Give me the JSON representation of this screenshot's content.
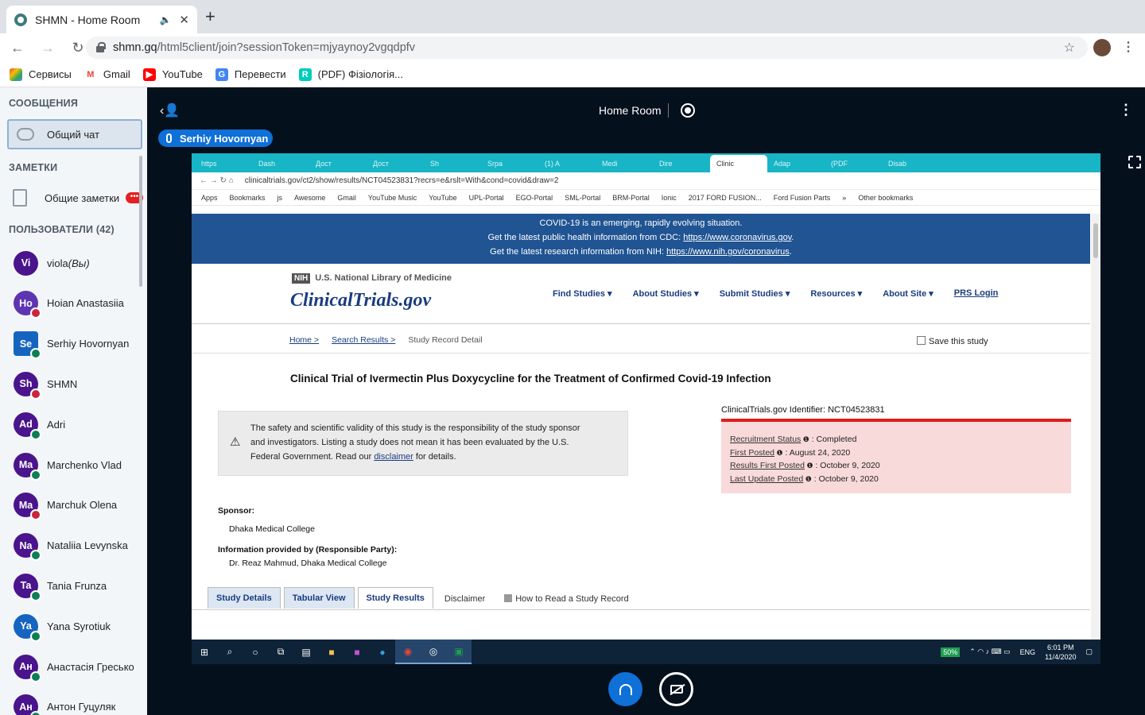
{
  "browser": {
    "tab_title": "SHMN - Home Room",
    "new_tab": "+",
    "url_host": "shmn.gq",
    "url_path": "/html5client/join?sessionToken=mjyaynoy2vgqdpfv",
    "bookmarks": [
      "Сервисы",
      "Gmail",
      "YouTube",
      "Перевести",
      "(PDF) Фізіологія..."
    ]
  },
  "sidebar": {
    "messages_header": "СООБЩЕНИЯ",
    "public_chat": "Общий чат",
    "notes_header": "ЗАМЕТКИ",
    "shared_notes": "Общие заметки",
    "notes_badge": "•••",
    "users_header": "ПОЛЬЗОВАТЕЛИ (42)",
    "users": [
      {
        "initials": "Vi",
        "name": "viola",
        "suffix": " (Вы)",
        "color": "#4a148c",
        "status": "none"
      },
      {
        "initials": "Ho",
        "name": "Hoian Anastasiia",
        "suffix": "",
        "color": "#5e35b1",
        "status": "mic"
      },
      {
        "initials": "Se",
        "name": "Serhiy Hovornyan",
        "suffix": "",
        "color": "#1565c0",
        "status": "hp"
      },
      {
        "initials": "Sh",
        "name": "SHMN",
        "suffix": "",
        "color": "#4a148c",
        "status": "mic"
      },
      {
        "initials": "Ad",
        "name": "Adri",
        "suffix": "",
        "color": "#4a148c",
        "status": "hp"
      },
      {
        "initials": "Ma",
        "name": "Marchenko Vlad",
        "suffix": "",
        "color": "#4a148c",
        "status": "hp"
      },
      {
        "initials": "Ma",
        "name": "Marchuk Olena",
        "suffix": "",
        "color": "#4a148c",
        "status": "mic"
      },
      {
        "initials": "Na",
        "name": "Nataliia Levynska",
        "suffix": "",
        "color": "#4a148c",
        "status": "hp"
      },
      {
        "initials": "Ta",
        "name": "Tania Frunza",
        "suffix": "",
        "color": "#4a148c",
        "status": "hp"
      },
      {
        "initials": "Ya",
        "name": "Yana Syrotiuk",
        "suffix": "",
        "color": "#1565c0",
        "status": "hp"
      },
      {
        "initials": "Ан",
        "name": "Анастасія Гресько",
        "suffix": "",
        "color": "#4a148c",
        "status": "hp"
      },
      {
        "initials": "Ан",
        "name": "Антон Гуцуляк",
        "suffix": "",
        "color": "#4a148c",
        "status": "hp"
      }
    ]
  },
  "room": {
    "title": "Home Room",
    "presenter": "Serhiy Hovornyan"
  },
  "shared": {
    "tabs": [
      "https",
      "Dash",
      "Дост",
      "Дост",
      "Sh",
      "Srpa",
      "(1) A",
      "Medi",
      "Dire",
      "Clinic",
      "Adap",
      "(PDF",
      "Disab"
    ],
    "active_tab": 9,
    "url": "clinicaltrials.gov/ct2/show/results/NCT04523831?recrs=e&rslt=With&cond=covid&draw=2",
    "bookmarks": [
      "Apps",
      "Bookmarks",
      "js",
      "Awesome",
      "Gmail",
      "YouTube Music",
      "YouTube",
      "UPL-Portal",
      "EGO-Portal",
      "SML-Portal",
      "BRM-Portal",
      "Ionic",
      "2017 FORD FUSION...",
      "Ford Fusion Parts",
      "»",
      "Other bookmarks"
    ],
    "banner_line1": "COVID-19 is an emerging, rapidly evolving situation.",
    "banner_line2": "Get the latest public health information from CDC: ",
    "banner_link2": "https://www.coronavirus.gov",
    "banner_line3": "Get the latest research information from NIH: ",
    "banner_link3": "https://www.nih.gov/coronavirus",
    "nih_badge": "NIH",
    "nih_label": "U.S. National Library of Medicine",
    "site_logo": "ClinicalTrials.gov",
    "nav": [
      "Find Studies ▾",
      "About Studies ▾",
      "Submit Studies ▾",
      "Resources ▾",
      "About Site ▾",
      "PRS Login"
    ],
    "crumbs": [
      "Home >",
      "Search Results >",
      "Study Record Detail"
    ],
    "save_label": "Save this study",
    "study_title": "Clinical Trial of Ivermectin Plus Doxycycline for the Treatment of Confirmed Covid-19 Infection",
    "disclaimer_1": "The safety and scientific validity of this study is the responsibility of the study sponsor",
    "disclaimer_2": "and investigators. Listing a study does not mean it has been evaluated by the U.S.",
    "disclaimer_3a": "Federal Government. Read our ",
    "disclaimer_link": "disclaimer",
    "disclaimer_3b": " for details.",
    "identifier": "ClinicalTrials.gov Identifier: NCT04523831",
    "status_rows": [
      {
        "label": "Recruitment Status",
        "value": " : Completed"
      },
      {
        "label": "First Posted",
        "value": " : August 24, 2020"
      },
      {
        "label": "Results First Posted",
        "value": " : October 9, 2020"
      },
      {
        "label": "Last Update Posted",
        "value": " : October 9, 2020"
      }
    ],
    "sponsor_label": "Sponsor:",
    "sponsor_value": "Dhaka Medical College",
    "info_label": "Information provided by (Responsible Party):",
    "info_value": "Dr. Reaz Mahmud, Dhaka Medical College",
    "bottom_tabs": [
      "Study Details",
      "Tabular View",
      "Study Results",
      "Disclaimer",
      "How to Read a Study Record"
    ],
    "taskbar": {
      "battery": "50%",
      "lang": "ENG",
      "time": "6:01 PM",
      "date": "11/4/2020"
    }
  }
}
